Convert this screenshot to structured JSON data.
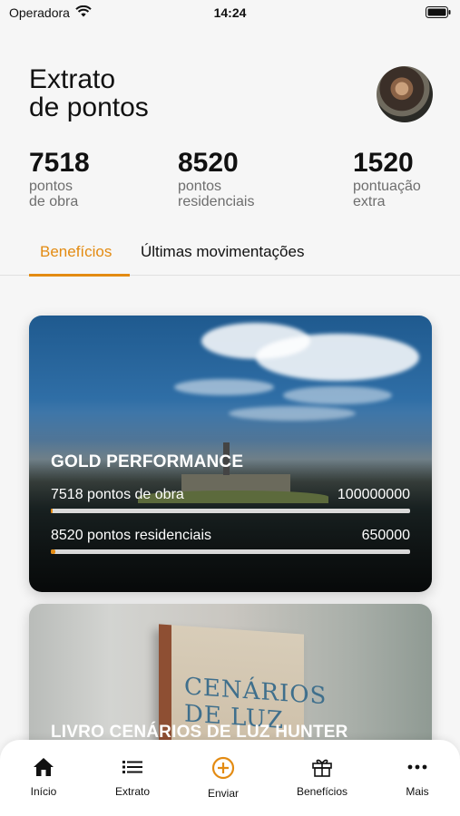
{
  "status": {
    "carrier": "Operadora",
    "time": "14:24"
  },
  "header": {
    "title_line1": "Extrato",
    "title_line2": "de pontos"
  },
  "stats": [
    {
      "value": "7518",
      "label": "pontos\nde obra"
    },
    {
      "value": "8520",
      "label": "pontos\nresidenciais"
    },
    {
      "value": "1520",
      "label": "pontuação\nextra"
    }
  ],
  "tabs": [
    {
      "label": "Benefícios",
      "active": true
    },
    {
      "label": "Últimas movimentações",
      "active": false
    }
  ],
  "cards": [
    {
      "title": "GOLD PERFORMANCE",
      "rows": [
        {
          "label": "7518 pontos de obra",
          "target": "100000000",
          "progress": 0.0001
        },
        {
          "label": "8520 pontos residenciais",
          "target": "650000",
          "progress": 0.013
        }
      ]
    },
    {
      "title": "LIVRO CENÁRIOS DE LUZ HUNTER",
      "book_text": "CENÁRIOS DE LUZ"
    }
  ],
  "nav": [
    {
      "label": "Início",
      "icon": "home-icon"
    },
    {
      "label": "Extrato",
      "icon": "list-icon"
    },
    {
      "label": "Enviar",
      "icon": "add-circle-icon"
    },
    {
      "label": "Benefícios",
      "icon": "gift-icon"
    },
    {
      "label": "Mais",
      "icon": "more-icon"
    }
  ],
  "colors": {
    "accent": "#e38b12",
    "bar_track": "#d9d9d9"
  }
}
